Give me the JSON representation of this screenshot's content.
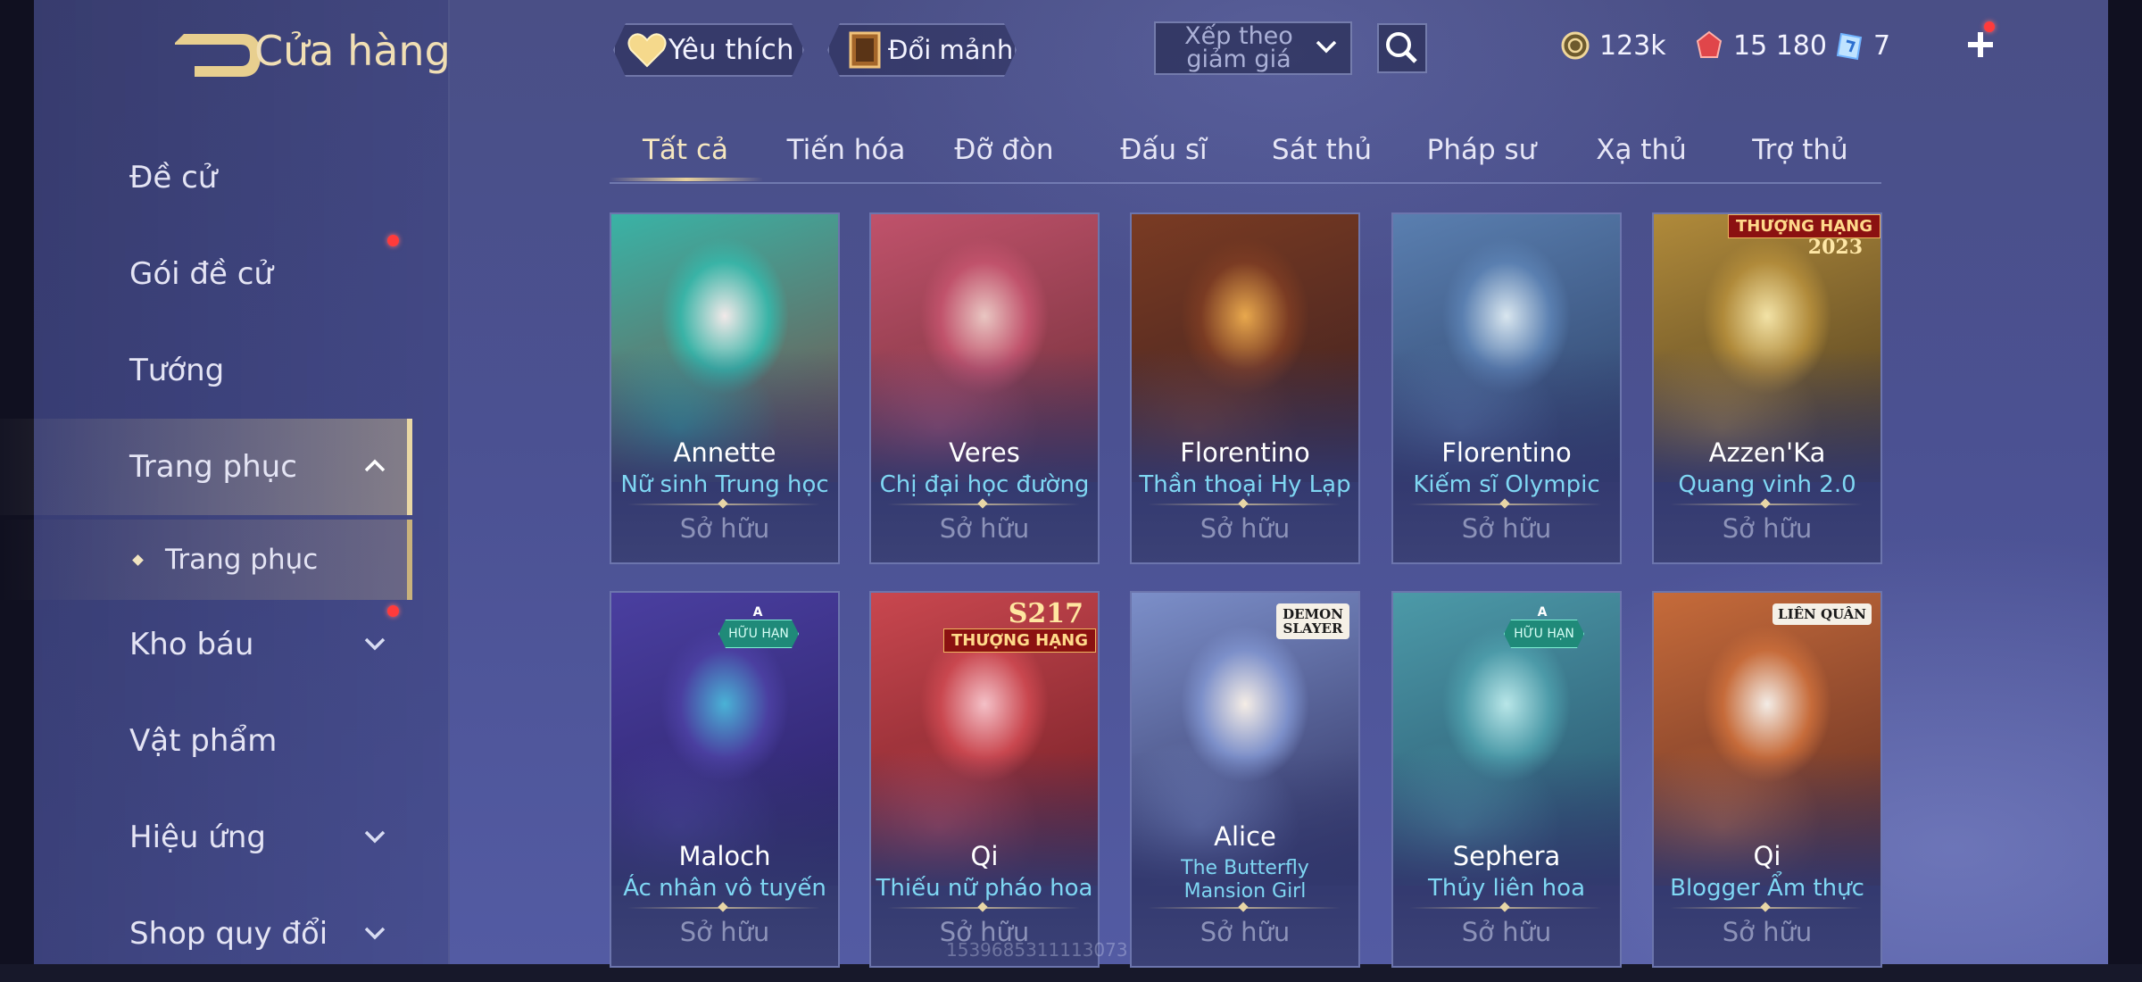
{
  "header": {
    "title": "Cửa hàng",
    "favorites_label": "Yêu thích",
    "exchange_label": "Đổi mảnh",
    "sort_label": "Xếp theo giảm giá",
    "currencies": [
      {
        "icon": "gold-coin-icon",
        "value": "123k"
      },
      {
        "icon": "ruby-icon",
        "value": "15 180"
      },
      {
        "icon": "voucher-icon",
        "value": "7"
      }
    ]
  },
  "sidebar": {
    "items": [
      {
        "label": "Đề cử",
        "has_dot": false,
        "expandable": false
      },
      {
        "label": "Gói đề cử",
        "has_dot": true,
        "expandable": false
      },
      {
        "label": "Tướng",
        "has_dot": false,
        "expandable": false
      },
      {
        "label": "Trang phục",
        "has_dot": false,
        "expandable": true,
        "expanded": true,
        "active": true
      },
      {
        "label": "Trang phục",
        "sub": true,
        "active": true
      },
      {
        "label": "Kho báu",
        "has_dot": true,
        "expandable": true
      },
      {
        "label": "Vật phẩm",
        "has_dot": false,
        "expandable": false
      },
      {
        "label": "Hiệu ứng",
        "has_dot": false,
        "expandable": true
      },
      {
        "label": "Shop quy đổi",
        "has_dot": false,
        "expandable": true
      }
    ]
  },
  "tabs": [
    {
      "label": "Tất cả",
      "active": true
    },
    {
      "label": "Tiến hóa"
    },
    {
      "label": "Đỡ đòn"
    },
    {
      "label": "Đấu sĩ"
    },
    {
      "label": "Sát thủ"
    },
    {
      "label": "Pháp sư"
    },
    {
      "label": "Xạ thủ"
    },
    {
      "label": "Trợ thủ"
    }
  ],
  "cards": [
    {
      "hero": "Annette",
      "skin": "Nữ sinh Trung học",
      "status": "Sở hữu",
      "colors": [
        "#f2e9e9",
        "#39b3a6",
        "#7a4b45"
      ]
    },
    {
      "hero": "Veres",
      "skin": "Chị đại học đường",
      "status": "Sở hữu",
      "colors": [
        "#e9c6c2",
        "#c0526b",
        "#6b2d36"
      ]
    },
    {
      "hero": "Florentino",
      "skin": "Thần thoại Hy Lạp",
      "status": "Sở hữu",
      "colors": [
        "#e8a84d",
        "#7a3b23",
        "#3b1f20"
      ]
    },
    {
      "hero": "Florentino",
      "skin": "Kiếm sĩ Olympic",
      "status": "Sở hữu",
      "colors": [
        "#d9e6ef",
        "#5a7fb0",
        "#2b3f66"
      ]
    },
    {
      "hero": "Azzen'Ka",
      "skin": "Quang vinh 2.0",
      "status": "Sở hữu",
      "badge_rank": "THƯỢNG HẠNG",
      "badge_year": "2023",
      "colors": [
        "#f2e2a6",
        "#b08a3a",
        "#4a3a1f"
      ]
    },
    {
      "hero": "Maloch",
      "skin": "Ác nhân vô tuyến",
      "status": "Sở hữu",
      "badge_limited": "HỮU HẠN",
      "badge_tier": "A",
      "colors": [
        "#4ab2d6",
        "#4a3fa0",
        "#2a2066"
      ]
    },
    {
      "hero": "Qi",
      "skin": "Thiếu nữ pháo hoa",
      "status": "Sở hữu",
      "badge_rank": "THƯỢNG HẠNG",
      "badge_season": "S217",
      "colors": [
        "#f4c0c7",
        "#c9474f",
        "#6a1b22"
      ]
    },
    {
      "hero": "Alice",
      "skin": "The Butterfly Mansion Girl",
      "status": "Sở hữu",
      "badge_logo": "DEMON SLAYER",
      "colors": [
        "#f5ede6",
        "#7c8fc9",
        "#2d2f5e"
      ]
    },
    {
      "hero": "Sephera",
      "skin": "Thủy liên hoa",
      "status": "Sở hữu",
      "badge_limited": "HỮU HẠN",
      "badge_tier": "A",
      "colors": [
        "#b8e6e8",
        "#4c9aa8",
        "#264d69"
      ]
    },
    {
      "hero": "Qi",
      "skin": "Blogger Ẩm thực",
      "status": "Sở hữu",
      "badge_logo": "LIÊN QUÂN",
      "colors": [
        "#f3ece6",
        "#c66b3a",
        "#5c2a22"
      ]
    }
  ],
  "watermark": "1539685311113073",
  "colors": {
    "accent_gold": "#f1dfb4",
    "skin_cyan": "#7fd7f3",
    "red_dot": "#ff3b3b"
  }
}
